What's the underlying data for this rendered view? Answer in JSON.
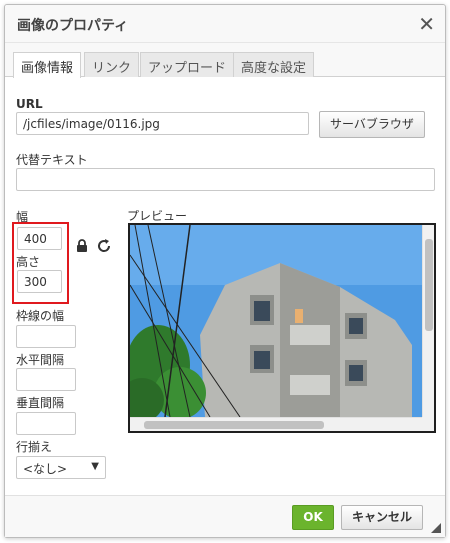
{
  "dialog": {
    "title": "画像のプロパティ",
    "close_glyph": "✕"
  },
  "tabs": [
    {
      "label": "画像情報",
      "active": true
    },
    {
      "label": "リンク",
      "active": false
    },
    {
      "label": "アップロード",
      "active": false
    },
    {
      "label": "高度な設定",
      "active": false
    }
  ],
  "url": {
    "label": "URL",
    "value": "/jcfiles/image/0116.jpg",
    "browse_button": "サーバブラウザ"
  },
  "alt_text": {
    "label": "代替テキスト",
    "value": ""
  },
  "size": {
    "width_label": "幅",
    "width_value": "400",
    "height_label": "高さ",
    "height_value": "300"
  },
  "icons": {
    "lock": "lock-icon",
    "reset": "reset-icon"
  },
  "preview": {
    "label": "プレビュー"
  },
  "border": {
    "label": "枠線の幅",
    "value": ""
  },
  "hspace": {
    "label": "水平間隔",
    "value": ""
  },
  "vspace": {
    "label": "垂直間隔",
    "value": ""
  },
  "align": {
    "label": "行揃え",
    "selected": "<なし>"
  },
  "footer": {
    "ok_label": "OK",
    "cancel_label": "キャンセル"
  },
  "colors": {
    "ok_green": "#6bb42d",
    "highlight_red": "#e0191e",
    "sky_blue": "#4f9be3"
  }
}
